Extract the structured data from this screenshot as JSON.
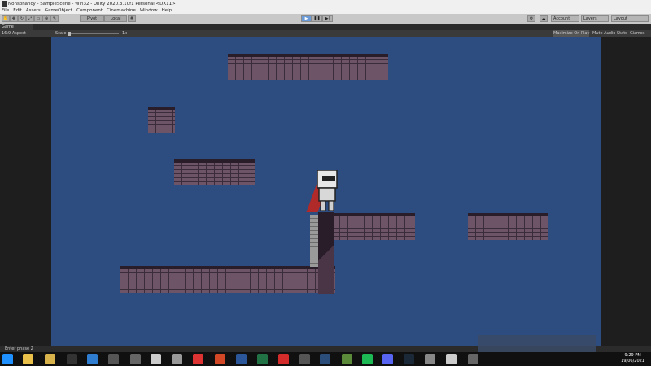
{
  "window": {
    "title": "Nonsonancy - SampleScene - Win32 - Unity 2020.3.10f1 Personal <DX11>"
  },
  "menu": [
    "File",
    "Edit",
    "Assets",
    "GameObject",
    "Component",
    "Cinemachine",
    "Window",
    "Help"
  ],
  "toolbar": {
    "pivot_label": "Pivot",
    "local_label": "Local",
    "play_icon": "play-icon",
    "pause_icon": "pause-icon",
    "step_icon": "step-icon",
    "account_label": "Account",
    "layers_label": "Layers",
    "layout_label": "Layout"
  },
  "game_view": {
    "tab_label": "Game",
    "aspect_label": "16:9 Aspect",
    "scale_label": "Scale",
    "scale_value": "1x",
    "maximize_label": "Maximize On Play",
    "mute_label": "Mute Audio",
    "stats_label": "Stats",
    "gizmos_label": "Gizmos"
  },
  "status": {
    "message": "Enter phase 2"
  },
  "taskbar": {
    "time": "9:29 PM",
    "date": "19/06/2021"
  },
  "colors": {
    "sky": "#2d4c7f",
    "brick": "#6e5467",
    "cape": "#b02a2a"
  }
}
